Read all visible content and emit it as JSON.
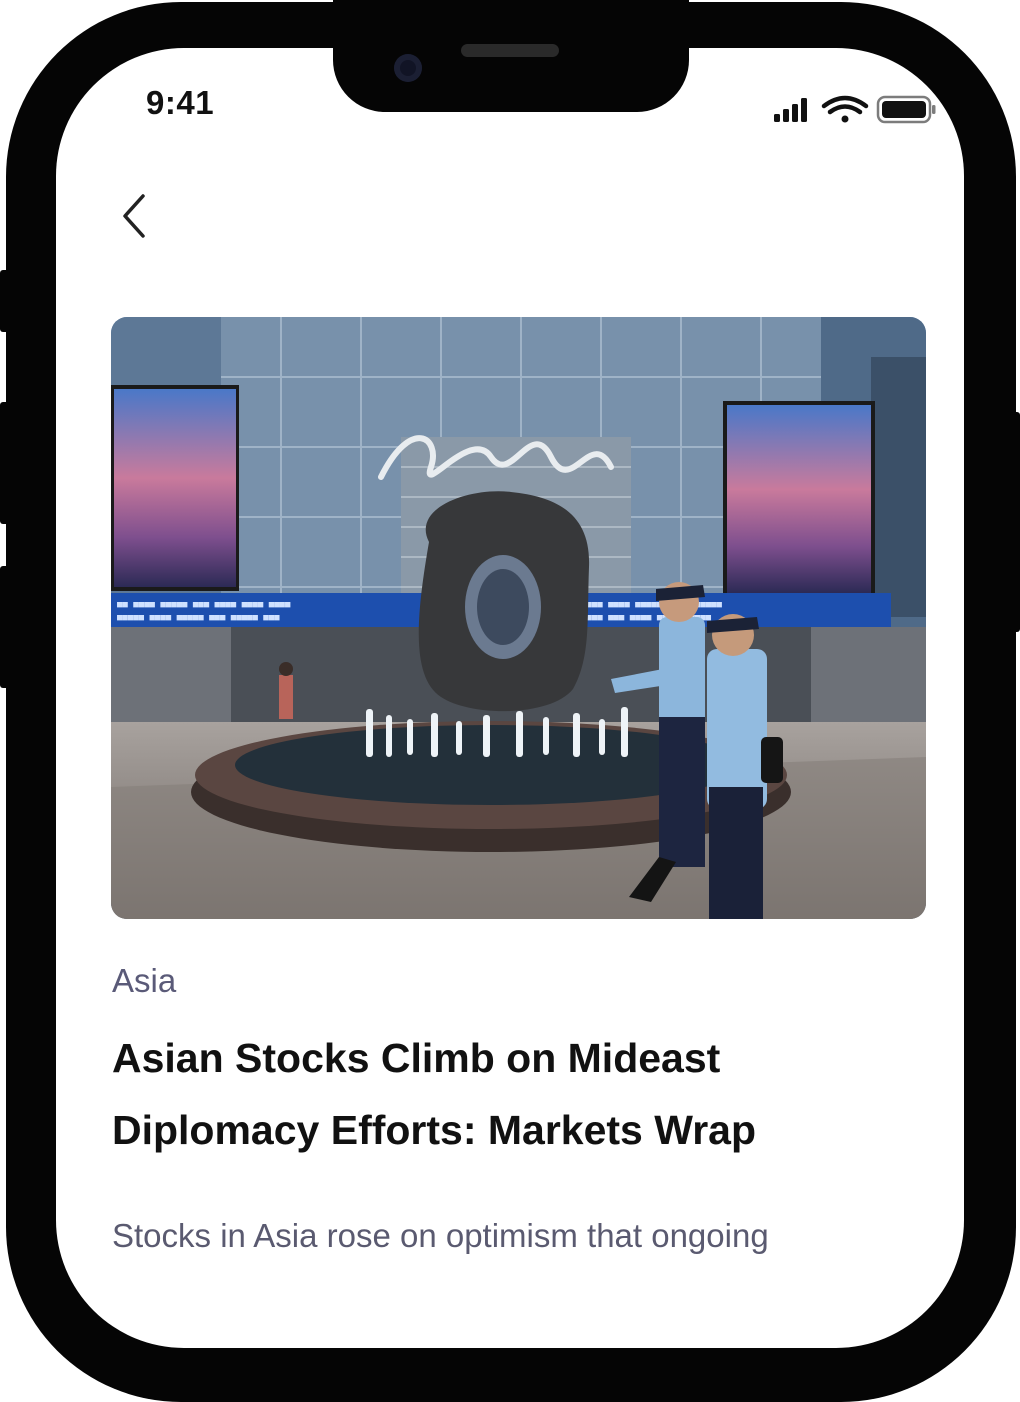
{
  "status_bar": {
    "time": "9:41",
    "icons": [
      "cellular-signal-icon",
      "wifi-icon",
      "battery-icon"
    ]
  },
  "nav": {
    "back_icon": "chevron-left-icon"
  },
  "article": {
    "category": "Asia",
    "headline": "Asian Stocks Climb on Mideast Diplomacy Efforts: Markets Wrap",
    "summary": "Stocks in Asia rose on optimism that ongoing"
  },
  "colors": {
    "frame": "#050505",
    "text_primary": "#111111",
    "text_secondary": "#5a5a78"
  }
}
